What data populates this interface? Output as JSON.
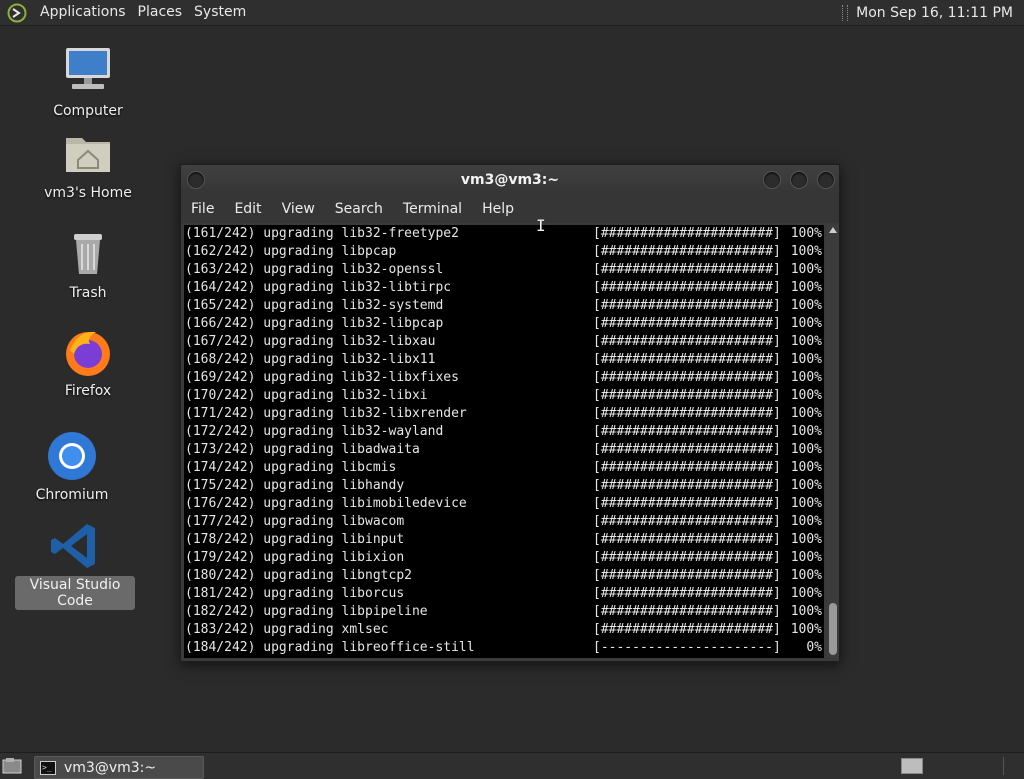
{
  "top_panel": {
    "menus": [
      "Applications",
      "Places",
      "System"
    ],
    "clock": "Mon Sep 16, 11:11 PM"
  },
  "desktop": {
    "icons": [
      {
        "label": "Computer",
        "icon": "computer-icon"
      },
      {
        "label": "vm3's Home",
        "icon": "home-folder-icon"
      },
      {
        "label": "Trash",
        "icon": "trash-icon"
      },
      {
        "label": "Firefox",
        "icon": "firefox-icon"
      },
      {
        "label": "Chromium",
        "icon": "chromium-icon"
      },
      {
        "label": "Visual Studio Code",
        "icon": "vscode-icon",
        "selected": true
      }
    ]
  },
  "terminal": {
    "title": "vm3@vm3:~",
    "menus": [
      "File",
      "Edit",
      "View",
      "Search",
      "Terminal",
      "Help"
    ],
    "lines": [
      {
        "text": "(161/242) upgrading lib32-freetype2",
        "bar": "[######################]",
        "pct": "100%"
      },
      {
        "text": "(162/242) upgrading libpcap",
        "bar": "[######################]",
        "pct": "100%"
      },
      {
        "text": "(163/242) upgrading lib32-openssl",
        "bar": "[######################]",
        "pct": "100%"
      },
      {
        "text": "(164/242) upgrading lib32-libtirpc",
        "bar": "[######################]",
        "pct": "100%"
      },
      {
        "text": "(165/242) upgrading lib32-systemd",
        "bar": "[######################]",
        "pct": "100%"
      },
      {
        "text": "(166/242) upgrading lib32-libpcap",
        "bar": "[######################]",
        "pct": "100%"
      },
      {
        "text": "(167/242) upgrading lib32-libxau",
        "bar": "[######################]",
        "pct": "100%"
      },
      {
        "text": "(168/242) upgrading lib32-libx11",
        "bar": "[######################]",
        "pct": "100%"
      },
      {
        "text": "(169/242) upgrading lib32-libxfixes",
        "bar": "[######################]",
        "pct": "100%"
      },
      {
        "text": "(170/242) upgrading lib32-libxi",
        "bar": "[######################]",
        "pct": "100%"
      },
      {
        "text": "(171/242) upgrading lib32-libxrender",
        "bar": "[######################]",
        "pct": "100%"
      },
      {
        "text": "(172/242) upgrading lib32-wayland",
        "bar": "[######################]",
        "pct": "100%"
      },
      {
        "text": "(173/242) upgrading libadwaita",
        "bar": "[######################]",
        "pct": "100%"
      },
      {
        "text": "(174/242) upgrading libcmis",
        "bar": "[######################]",
        "pct": "100%"
      },
      {
        "text": "(175/242) upgrading libhandy",
        "bar": "[######################]",
        "pct": "100%"
      },
      {
        "text": "(176/242) upgrading libimobiledevice",
        "bar": "[######################]",
        "pct": "100%"
      },
      {
        "text": "(177/242) upgrading libwacom",
        "bar": "[######################]",
        "pct": "100%"
      },
      {
        "text": "(178/242) upgrading libinput",
        "bar": "[######################]",
        "pct": "100%"
      },
      {
        "text": "(179/242) upgrading libixion",
        "bar": "[######################]",
        "pct": "100%"
      },
      {
        "text": "(180/242) upgrading libngtcp2",
        "bar": "[######################]",
        "pct": "100%"
      },
      {
        "text": "(181/242) upgrading liborcus",
        "bar": "[######################]",
        "pct": "100%"
      },
      {
        "text": "(182/242) upgrading libpipeline",
        "bar": "[######################]",
        "pct": "100%"
      },
      {
        "text": "(183/242) upgrading xmlsec",
        "bar": "[######################]",
        "pct": "100%"
      },
      {
        "text": "(184/242) upgrading libreoffice-still",
        "bar": "[----------------------]",
        "pct": "0%"
      }
    ]
  },
  "taskbar": {
    "tasks": [
      {
        "label": "vm3@vm3:~",
        "icon": "terminal-icon"
      }
    ]
  },
  "colors": {
    "desktop_bg": "#2b2b2b",
    "panel_bg": "#2f2f2f",
    "terminal_bg": "#000000",
    "terminal_fg": "#e6e6e6",
    "selection": "#6a6a6a"
  }
}
